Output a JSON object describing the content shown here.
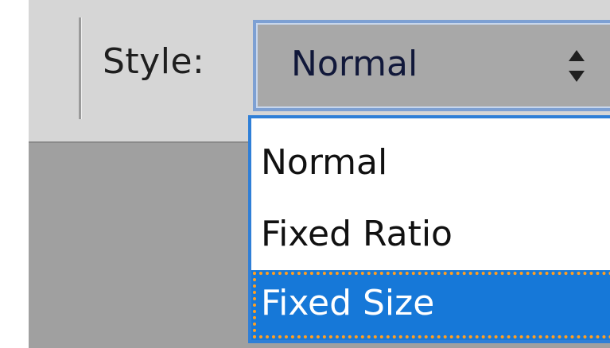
{
  "toolbar": {
    "style_label": "Style:"
  },
  "style_select": {
    "value": "Normal",
    "arrow_icon": "updown-arrows-icon",
    "options": [
      {
        "label": "Normal"
      },
      {
        "label": "Fixed Ratio"
      },
      {
        "label": "Fixed Size"
      }
    ],
    "highlighted": "Fixed Size"
  },
  "colors": {
    "accent": "#1678d8",
    "focus_border": "#2f7fd7",
    "focus_ring": "#ff9f22",
    "toolbar_bg": "#d6d6d6",
    "canvas_bg": "#a0a0a0"
  }
}
